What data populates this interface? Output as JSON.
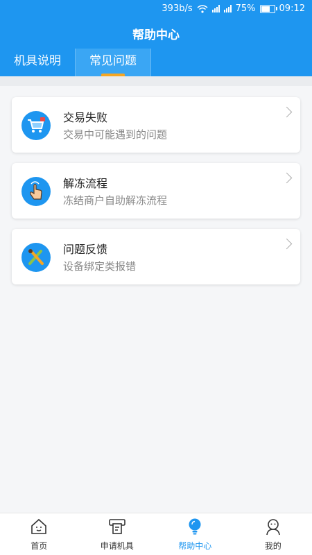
{
  "status_bar": {
    "speed": "393b/s",
    "battery": "75%",
    "battery_level": 0.75,
    "time": "09:12"
  },
  "header": {
    "title": "帮助中心"
  },
  "tabs": [
    {
      "label": "机具说明",
      "active": false
    },
    {
      "label": "常见问题",
      "active": true
    }
  ],
  "items": [
    {
      "title": "交易失败",
      "subtitle": "交易中可能遇到的问题",
      "icon": "shopping-cart-icon"
    },
    {
      "title": "解冻流程",
      "subtitle": "冻结商户自助解冻流程",
      "icon": "tap-hand-icon"
    },
    {
      "title": "问题反馈",
      "subtitle": "设备绑定类报错",
      "icon": "tools-icon"
    }
  ],
  "bottom_nav": [
    {
      "label": "首页",
      "icon": "home-icon"
    },
    {
      "label": "申请机具",
      "icon": "pos-terminal-icon"
    },
    {
      "label": "帮助中心",
      "icon": "lightbulb-icon",
      "active": true
    },
    {
      "label": "我的",
      "icon": "user-icon"
    }
  ],
  "colors": {
    "primary": "#1e96f0",
    "tab_indicator": "#f5a623"
  }
}
